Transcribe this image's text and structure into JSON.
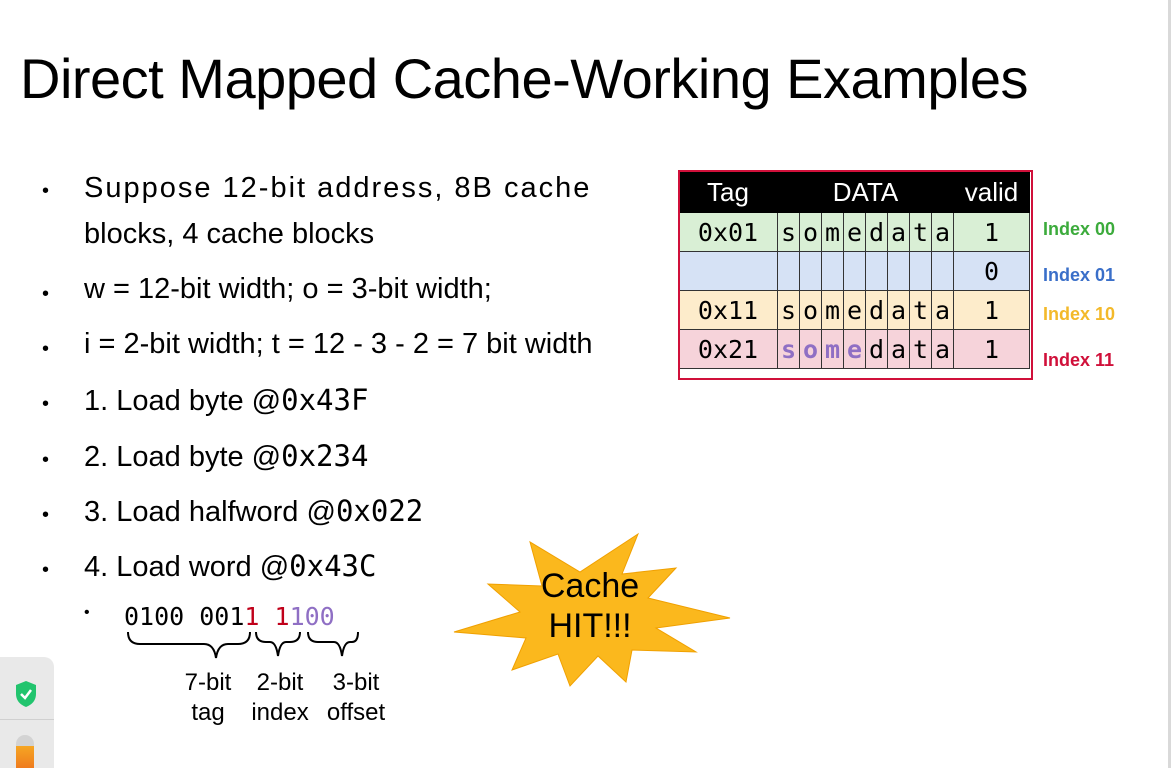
{
  "title": "Direct Mapped Cache-Working Examples",
  "bullets": [
    {
      "text1": "Suppose 12-bit address, 8B cache",
      "text2": "blocks, 4 cache blocks"
    },
    {
      "text": "w = 12-bit width; o = 3-bit width;"
    },
    {
      "text": "i = 2-bit width; t = 12 - 3 - 2 = 7 bit width"
    },
    {
      "prefix": "1. Load byte @",
      "addr": "0x43F"
    },
    {
      "prefix": "2. Load byte @",
      "addr": "0x234"
    },
    {
      "prefix": "3. Load halfword @",
      "addr": "0x022"
    },
    {
      "prefix": "4. Load word @",
      "addr": "0x43C"
    }
  ],
  "bullet_symbol": "•",
  "address_breakdown": {
    "tag_bits": "0100 001",
    "index_bits": "1 1",
    "offset_bits": "100",
    "tag_label": [
      "7-bit",
      "tag"
    ],
    "index_label": [
      "2-bit",
      "index"
    ],
    "offset_label": [
      "3-bit",
      "offset"
    ]
  },
  "cache_table": {
    "headers": {
      "tag": "Tag",
      "data": "DATA",
      "valid": "valid"
    },
    "rows": [
      {
        "tag": "0x01",
        "data": [
          "s",
          "o",
          "m",
          "e",
          "d",
          "a",
          "t",
          "a"
        ],
        "valid": "1",
        "index_label": "Index 00",
        "color": "#d9efd5",
        "label_color": "#3cab3c"
      },
      {
        "tag": "",
        "data": [
          "",
          "",
          "",
          "",
          "",
          "",
          "",
          ""
        ],
        "valid": "0",
        "index_label": "Index 01",
        "color": "#d6e2f5",
        "label_color": "#3a6fc9"
      },
      {
        "tag": "0x11",
        "data": [
          "s",
          "o",
          "m",
          "e",
          "d",
          "a",
          "t",
          "a"
        ],
        "valid": "1",
        "index_label": "Index 10",
        "color": "#fdeccb",
        "label_color": "#f3b92a"
      },
      {
        "tag": "0x21",
        "data": [
          "s",
          "o",
          "m",
          "e",
          "d",
          "a",
          "t",
          "a"
        ],
        "valid": "1",
        "index_label": "Index 11",
        "color": "#f6d3da",
        "label_color": "#d0103a"
      }
    ],
    "highlight_color": "#8f6fc4"
  },
  "callout": {
    "line1": "Cache",
    "line2": "HIT!!!",
    "color": "#fbb81d"
  },
  "colors": {
    "index_bits": "#c0001a",
    "offset_bits": "#8f6fc4"
  }
}
